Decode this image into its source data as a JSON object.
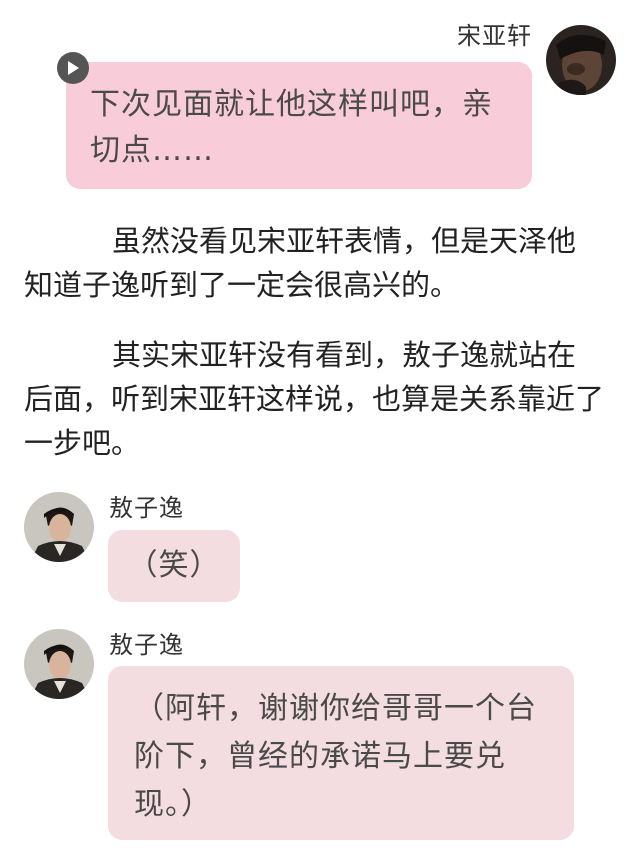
{
  "messages": [
    {
      "sender": "宋亚轩",
      "side": "right",
      "text": "下次见面就让他这样叫吧，亲切点……",
      "bubble_color": "#f8ccd8",
      "icon": "play-icon"
    },
    {
      "sender": "敖子逸",
      "side": "left",
      "text": "（笑）",
      "bubble_color": "#f4dde1"
    },
    {
      "sender": "敖子逸",
      "side": "left",
      "text": "（阿轩，谢谢你给哥哥一个台阶下，曾经的承诺马上要兑现。）",
      "bubble_color": "#f4dde1"
    }
  ],
  "narration": [
    "虽然没看见宋亚轩表情，但是天泽他知道子逸听到了一定会很高兴的。",
    "其实宋亚轩没有看到，敖子逸就站在后面，听到宋亚轩这样说，也算是关系靠近了一步吧。"
  ]
}
